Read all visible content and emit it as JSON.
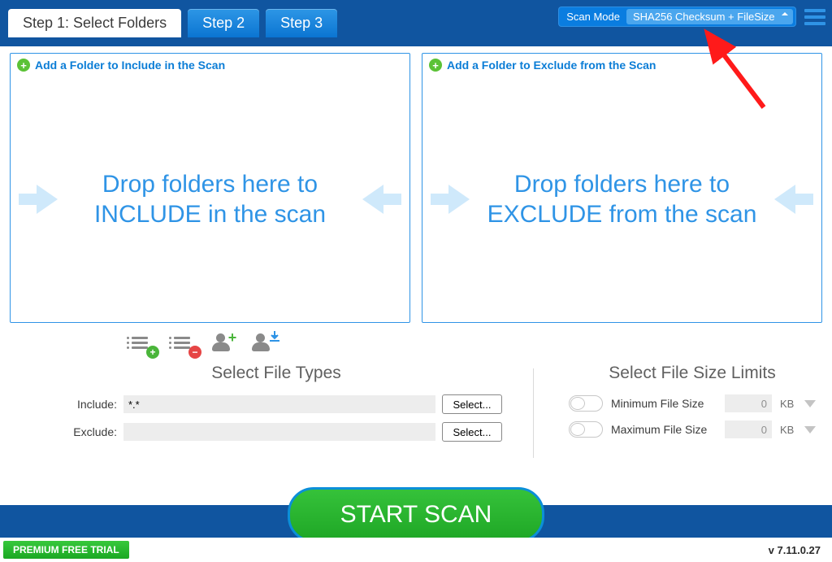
{
  "tabs": {
    "step1": "Step 1: Select Folders",
    "step2": "Step 2",
    "step3": "Step 3"
  },
  "scanmode": {
    "label": "Scan Mode",
    "selected": "SHA256 Checksum + FileSize"
  },
  "include_panel": {
    "add_link": "Add a Folder to Include in the Scan",
    "dropzone": "Drop folders here to INCLUDE in the scan"
  },
  "exclude_panel": {
    "add_link": "Add a Folder to Exclude from the Scan",
    "dropzone": "Drop folders here to EXCLUDE from the scan"
  },
  "filetypes": {
    "title": "Select File Types",
    "include_label": "Include:",
    "include_value": "*.*",
    "exclude_label": "Exclude:",
    "exclude_value": "",
    "select_btn": "Select..."
  },
  "filesize": {
    "title": "Select File Size Limits",
    "min_label": "Minimum File Size",
    "max_label": "Maximum File Size",
    "min_value": "0",
    "max_value": "0",
    "unit": "KB"
  },
  "buttons": {
    "start": "START SCAN",
    "premium": "PREMIUM FREE TRIAL"
  },
  "version": "v 7.11.0.27"
}
